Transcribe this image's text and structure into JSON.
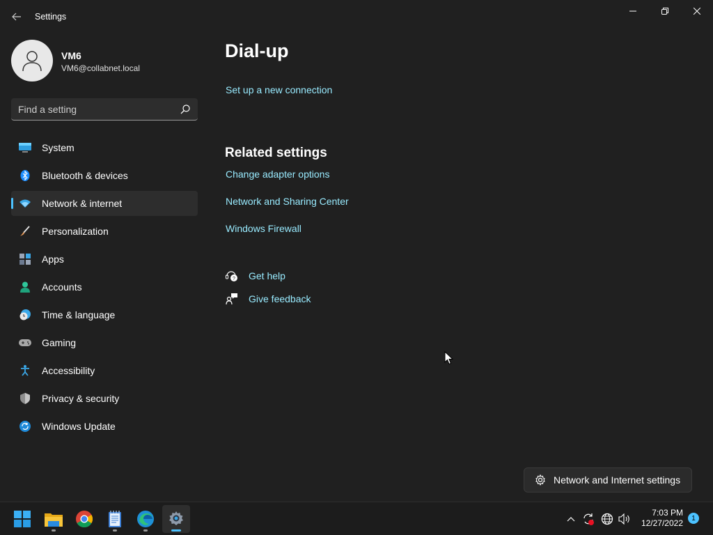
{
  "window": {
    "title": "Settings"
  },
  "profile": {
    "name": "VM6",
    "email": "VM6@collabnet.local"
  },
  "search": {
    "placeholder": "Find a setting"
  },
  "sidebar": {
    "items": [
      {
        "label": "System",
        "icon": "monitor-icon"
      },
      {
        "label": "Bluetooth & devices",
        "icon": "bluetooth-icon"
      },
      {
        "label": "Network & internet",
        "icon": "wifi-icon",
        "active": true
      },
      {
        "label": "Personalization",
        "icon": "brush-icon"
      },
      {
        "label": "Apps",
        "icon": "apps-icon"
      },
      {
        "label": "Accounts",
        "icon": "person-icon"
      },
      {
        "label": "Time & language",
        "icon": "clock-globe-icon"
      },
      {
        "label": "Gaming",
        "icon": "gamepad-icon"
      },
      {
        "label": "Accessibility",
        "icon": "accessibility-icon"
      },
      {
        "label": "Privacy & security",
        "icon": "shield-icon"
      },
      {
        "label": "Windows Update",
        "icon": "update-icon"
      }
    ]
  },
  "main": {
    "title": "Dial-up",
    "setup_link": "Set up a new connection",
    "related_title": "Related settings",
    "related_links": [
      "Change adapter options",
      "Network and Sharing Center",
      "Windows Firewall"
    ],
    "help": "Get help",
    "feedback": "Give feedback"
  },
  "tooltip": {
    "text": "Network and Internet settings"
  },
  "taskbar": {
    "apps": [
      "start-icon",
      "file-explorer-icon",
      "chrome-icon",
      "notepad-icon",
      "edge-icon",
      "settings-icon"
    ],
    "time": "7:03 PM",
    "date": "12/27/2022",
    "notification_count": "1"
  },
  "colors": {
    "accent": "#4cc2ff",
    "link": "#99ebff",
    "background": "#202020"
  }
}
